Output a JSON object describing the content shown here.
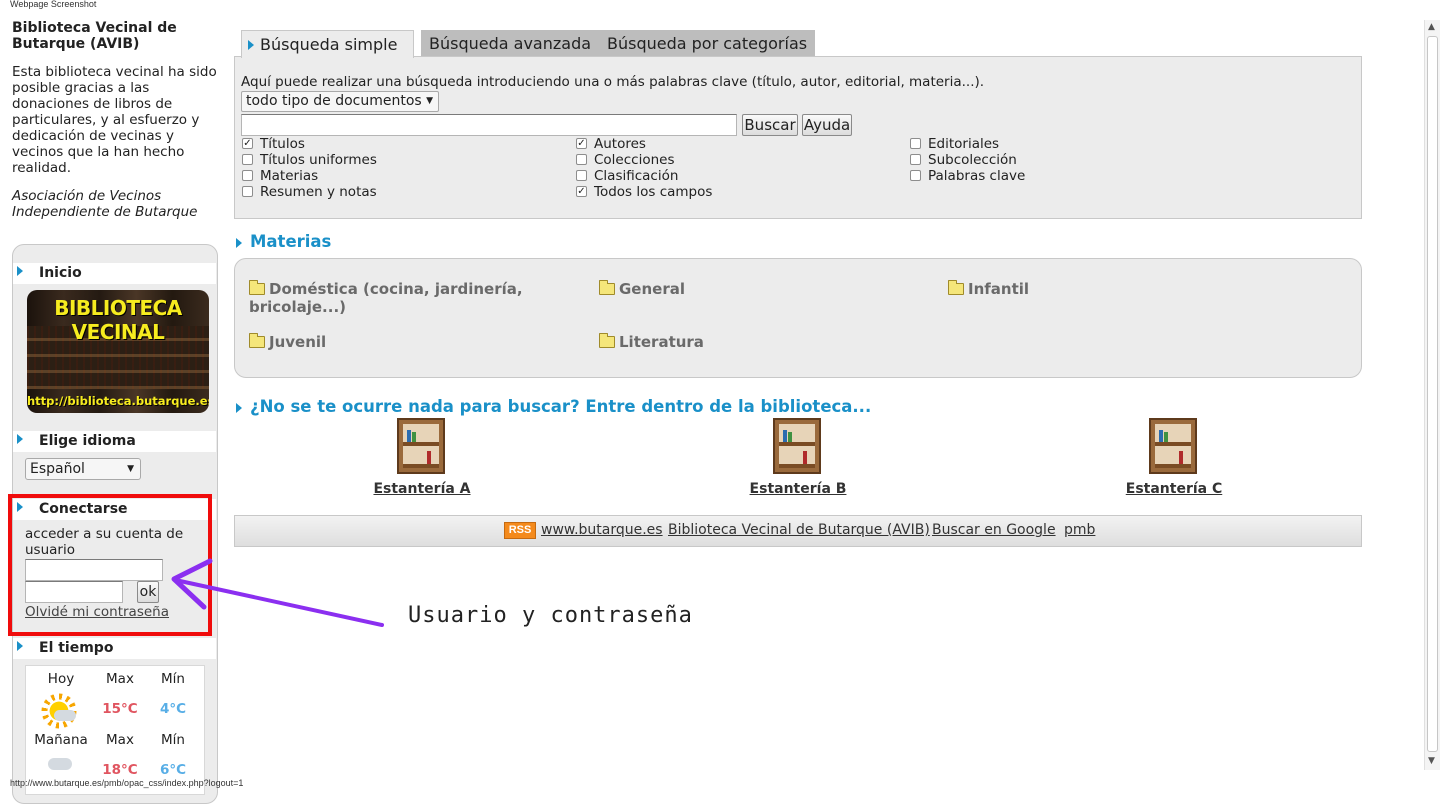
{
  "screenshot_label": "Webpage Screenshot",
  "status_url": "http://www.butarque.es/pmb/opac_css/index.php?logout=1",
  "library": {
    "title": "Biblioteca Vecinal de Butarque (AVIB)",
    "description": "Esta biblioteca vecinal ha sido posible gracias a las donaciones de libros de particulares, y al esfuerzo y dedicación de vecinas y vecinos que la han hecho realidad.",
    "association": "Asociación de Vecinos Independiente de Butarque"
  },
  "sidebar": {
    "home_label": "Inicio",
    "banner_title": "BIBLIOTECA VECINAL",
    "banner_url": "http://biblioteca.butarque.es",
    "language_label": "Elige idioma",
    "language_selected": "Español",
    "login_label": "Conectarse",
    "login_text": "acceder a su cuenta de usuario",
    "ok_label": "ok",
    "forgot_label": "Olvidé mi contraseña",
    "weather_label": "El tiempo",
    "weather": {
      "today": "Hoy",
      "tomorrow": "Mañana",
      "max": "Max",
      "min": "Mín",
      "today_max": "15°C",
      "today_min": "4°C",
      "tomorrow_max": "18°C",
      "tomorrow_min": "6°C"
    }
  },
  "tabs": [
    {
      "label": "Búsqueda simple",
      "active": true
    },
    {
      "label": "Búsqueda avanzada",
      "active": false
    },
    {
      "label": "Búsqueda por categorías",
      "active": false
    }
  ],
  "search": {
    "hint": "Aquí puede realizar una búsqueda introduciendo una o más palabras clave (título, autor, editorial, materia...).",
    "doc_type": "todo tipo de documentos",
    "query_value": "",
    "search_button": "Buscar",
    "help_button": "Ayuda",
    "fields": [
      {
        "label": "Títulos",
        "checked": true
      },
      {
        "label": "Títulos uniformes",
        "checked": false
      },
      {
        "label": "Materias",
        "checked": false
      },
      {
        "label": "Resumen y notas",
        "checked": false
      },
      {
        "label": "Autores",
        "checked": true
      },
      {
        "label": "Colecciones",
        "checked": false
      },
      {
        "label": "Clasificación",
        "checked": false
      },
      {
        "label": "Todos los campos",
        "checked": true
      },
      {
        "label": "Editoriales",
        "checked": false
      },
      {
        "label": "Subcolección",
        "checked": false
      },
      {
        "label": "Palabras clave",
        "checked": false
      }
    ]
  },
  "subjects": {
    "title": "Materias",
    "items": [
      "Doméstica (cocina, jardinería, bricolaje...)",
      "General",
      "Infantil",
      "Juvenil",
      "Literatura"
    ]
  },
  "browse": {
    "title": "¿No se te ocurre nada para buscar? Entre dentro de la biblioteca...",
    "shelves": [
      "Estantería A",
      "Estantería B",
      "Estantería C"
    ]
  },
  "footer": {
    "rss": "RSS",
    "links": [
      "www.butarque.es",
      "Biblioteca Vecinal de Butarque (AVIB)",
      "Buscar en Google",
      "pmb"
    ]
  },
  "annotation": {
    "text": "Usuario y contraseña",
    "arrow_color": "#8b2ff0",
    "frame_color": "#f00c0c"
  },
  "colors": {
    "accent": "#1a90c8",
    "panel": "#ececec",
    "banner_text": "#f7ec1f"
  }
}
